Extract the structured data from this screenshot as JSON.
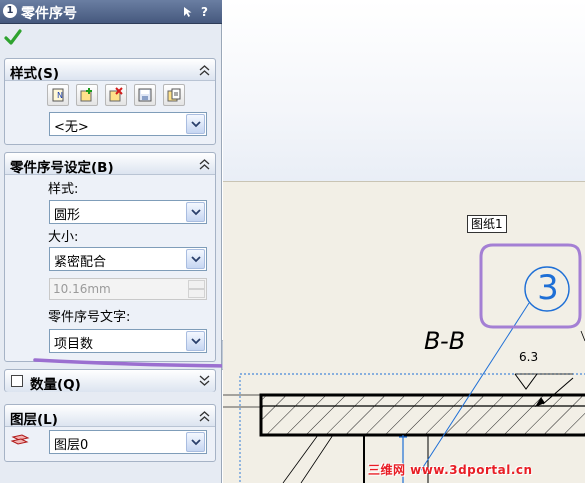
{
  "property_manager": {
    "title": "零件序号",
    "help_label": "?",
    "confirm_icon": "checkmark-icon",
    "style_group": {
      "title": "样式(S)",
      "toolbar_icons": [
        "balloon-new-icon",
        "balloon-add-icon",
        "balloon-delete-icon",
        "balloon-save-icon",
        "balloon-load-icon"
      ],
      "preset_value": "<无>"
    },
    "settings_group": {
      "title": "零件序号设定(B)",
      "style_label": "样式:",
      "style_value": "圆形",
      "size_label": "大小:",
      "size_value": "紧密配合",
      "custom_size_value": "10.16mm",
      "text_label": "零件序号文字:",
      "text_value": "项目数"
    },
    "quantity_group": {
      "title": "数量(Q)",
      "checked": false
    },
    "layer_group": {
      "title": "图层(L)",
      "layer_value": "图层0"
    }
  },
  "drawing": {
    "sheet_tab": "图纸1",
    "view_label": "B-B",
    "balloon_number": "3",
    "roughness_value": "6.3",
    "watermark": "三维网 www.3dportal.cn"
  },
  "colors": {
    "header_bg": "#50648a",
    "panel_bg": "#e6ebf3",
    "balloon_blue": "#1e6fd6",
    "highlight_purple": "#9b6fd0",
    "watermark_red": "#e81e25"
  }
}
